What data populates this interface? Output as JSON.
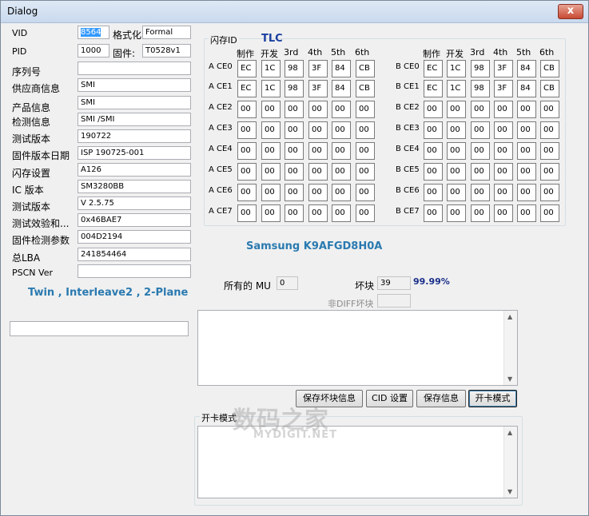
{
  "window": {
    "title": "Dialog",
    "close": "x"
  },
  "left": {
    "vid_label": "VID",
    "vid_value": "8564",
    "format_label": "格式化",
    "format_value": "Formal",
    "pid_label": "PID",
    "pid_value": "1000",
    "fw_label": "固件:",
    "fw_value": "T0528v1",
    "rows": [
      {
        "label": "序列号",
        "value": ""
      },
      {
        "label": "供应商信息",
        "value": "SMI"
      },
      {
        "label": "产品信息",
        "value": "SMI"
      },
      {
        "label": "检测信息",
        "value": "SMI     /SMI"
      },
      {
        "label": "测试版本",
        "value": "190722"
      },
      {
        "label": "固件版本日期",
        "value": "ISP 190725-001"
      },
      {
        "label": "闪存设置",
        "value": "A126"
      },
      {
        "label": "IC 版本",
        "value": "SM3280BB"
      },
      {
        "label": "测试版本",
        "value": "V 2.5.75"
      },
      {
        "label": "测试效验和...",
        "value": "0x46BAE7"
      },
      {
        "label": "固件检测参数",
        "value": "004D2194"
      },
      {
        "label": "总LBA",
        "value": "241854464"
      },
      {
        "label": "PSCN Ver",
        "value": ""
      }
    ],
    "mode_text": "Twin , Interleave2 , 2-Plane",
    "bottom_field": ""
  },
  "flash": {
    "group_label": "闪存ID",
    "type": "TLC",
    "headers": [
      "制作",
      "开发",
      "3rd",
      "4th",
      "5th",
      "6th"
    ],
    "a_labels": [
      "A CE0",
      "A CE1",
      "A CE2",
      "A CE3",
      "A CE4",
      "A CE5",
      "A CE6",
      "A CE7"
    ],
    "b_labels": [
      "B CE0",
      "B CE1",
      "B CE2",
      "B CE3",
      "B CE4",
      "B CE5",
      "B CE6",
      "B CE7"
    ],
    "a_values": [
      [
        "EC",
        "1C",
        "98",
        "3F",
        "84",
        "CB"
      ],
      [
        "EC",
        "1C",
        "98",
        "3F",
        "84",
        "CB"
      ],
      [
        "00",
        "00",
        "00",
        "00",
        "00",
        "00"
      ],
      [
        "00",
        "00",
        "00",
        "00",
        "00",
        "00"
      ],
      [
        "00",
        "00",
        "00",
        "00",
        "00",
        "00"
      ],
      [
        "00",
        "00",
        "00",
        "00",
        "00",
        "00"
      ],
      [
        "00",
        "00",
        "00",
        "00",
        "00",
        "00"
      ],
      [
        "00",
        "00",
        "00",
        "00",
        "00",
        "00"
      ]
    ],
    "b_values": [
      [
        "EC",
        "1C",
        "98",
        "3F",
        "84",
        "CB"
      ],
      [
        "EC",
        "1C",
        "98",
        "3F",
        "84",
        "CB"
      ],
      [
        "00",
        "00",
        "00",
        "00",
        "00",
        "00"
      ],
      [
        "00",
        "00",
        "00",
        "00",
        "00",
        "00"
      ],
      [
        "00",
        "00",
        "00",
        "00",
        "00",
        "00"
      ],
      [
        "00",
        "00",
        "00",
        "00",
        "00",
        "00"
      ],
      [
        "00",
        "00",
        "00",
        "00",
        "00",
        "00"
      ],
      [
        "00",
        "00",
        "00",
        "00",
        "00",
        "00"
      ]
    ],
    "part_number": "Samsung K9AFGD8H0A"
  },
  "stats": {
    "mu_label": "所有的 MU",
    "mu_value": "0",
    "bad_label": "坏块",
    "bad_value": "39",
    "percent": "99.99%",
    "nondiff_label": "非DIFF坏块",
    "nondiff_value": ""
  },
  "buttons": {
    "save_bad": "保存坏块信息",
    "cid": "CID 设置",
    "save_info": "保存信息",
    "open_mode": "开卡模式"
  },
  "open_mode_group": "开卡模式",
  "watermark": {
    "brand": "数码之家",
    "url": "MYDIGIT.NET"
  },
  "colors": {
    "accent_blue": "#2a7ab0",
    "tlc_blue": "#1a3fa0",
    "percent_blue": "#1a2f8a"
  }
}
